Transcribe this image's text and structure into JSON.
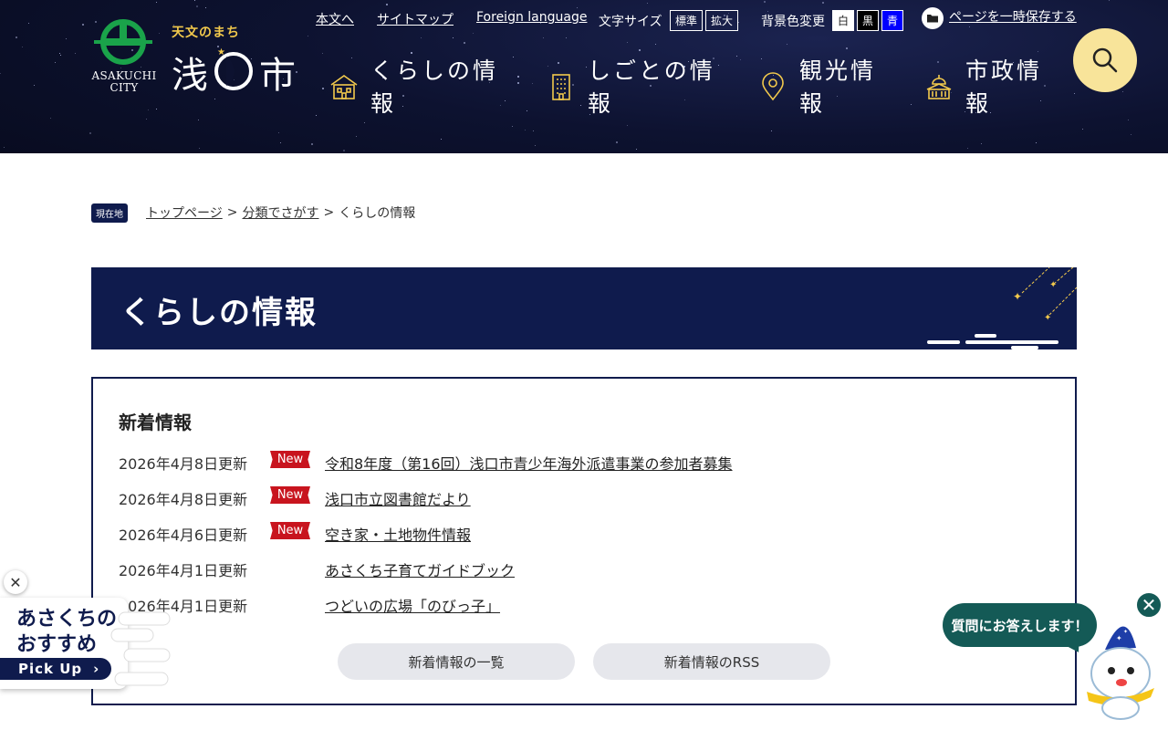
{
  "header": {
    "tagline": "天文のまち",
    "city_name": "浅口市",
    "city_en_1": "ASAKUCHI",
    "city_en_2": "CITY",
    "utility": {
      "skip_link": "本文へ",
      "sitemap": "サイトマップ",
      "foreign": "Foreign language",
      "font_size_label": "文字サイズ",
      "font_standard": "標準",
      "font_large": "拡大",
      "bg_color_label": "背景色変更",
      "bg_white": "白",
      "bg_black": "黒",
      "bg_blue": "青",
      "save_page": "ページを一時保存する"
    },
    "nav": [
      {
        "label": "くらしの情報",
        "icon": "house-icon"
      },
      {
        "label": "しごとの情報",
        "icon": "building-icon"
      },
      {
        "label": "観光情報",
        "icon": "map-pin-icon"
      },
      {
        "label": "市政情報",
        "icon": "city-hall-icon"
      }
    ],
    "search_icon": "search-icon"
  },
  "breadcrumb": {
    "badge": "現在地",
    "items": [
      "トップページ",
      "分類でさがす",
      "くらしの情報"
    ],
    "separator": ">"
  },
  "page_title": "くらしの情報",
  "news": {
    "heading": "新着情報",
    "new_badge": "New",
    "items": [
      {
        "date": "2026年4月8日更新",
        "title": "令和8年度（第16回）浅口市青少年海外派遣事業の参加者募集",
        "is_new": true
      },
      {
        "date": "2026年4月8日更新",
        "title": "浅口市立図書館だより",
        "is_new": true
      },
      {
        "date": "2026年4月6日更新",
        "title": "空き家・土地物件情報",
        "is_new": true
      },
      {
        "date": "2026年4月1日更新",
        "title": "あさくち子育てガイドブック",
        "is_new": false
      },
      {
        "date": "2026年4月1日更新",
        "title": "つどいの広場「のびっ子」",
        "is_new": false
      }
    ],
    "list_button": "新着情報の一覧",
    "rss_button": "新着情報のRSS"
  },
  "pickup": {
    "line1": "あさくちの",
    "line2": "おすすめ",
    "button": "Pick Up"
  },
  "chat": {
    "bubble": "質問にお答えします！"
  },
  "colors": {
    "navy": "#0f1b4d",
    "header_bg": "#0d1230",
    "accent_yellow": "#f8e49a",
    "new_red": "#c8141e",
    "chat_teal": "#145a56",
    "logo_green": "#1aa34a",
    "tagline_gold": "#f2c94c"
  }
}
